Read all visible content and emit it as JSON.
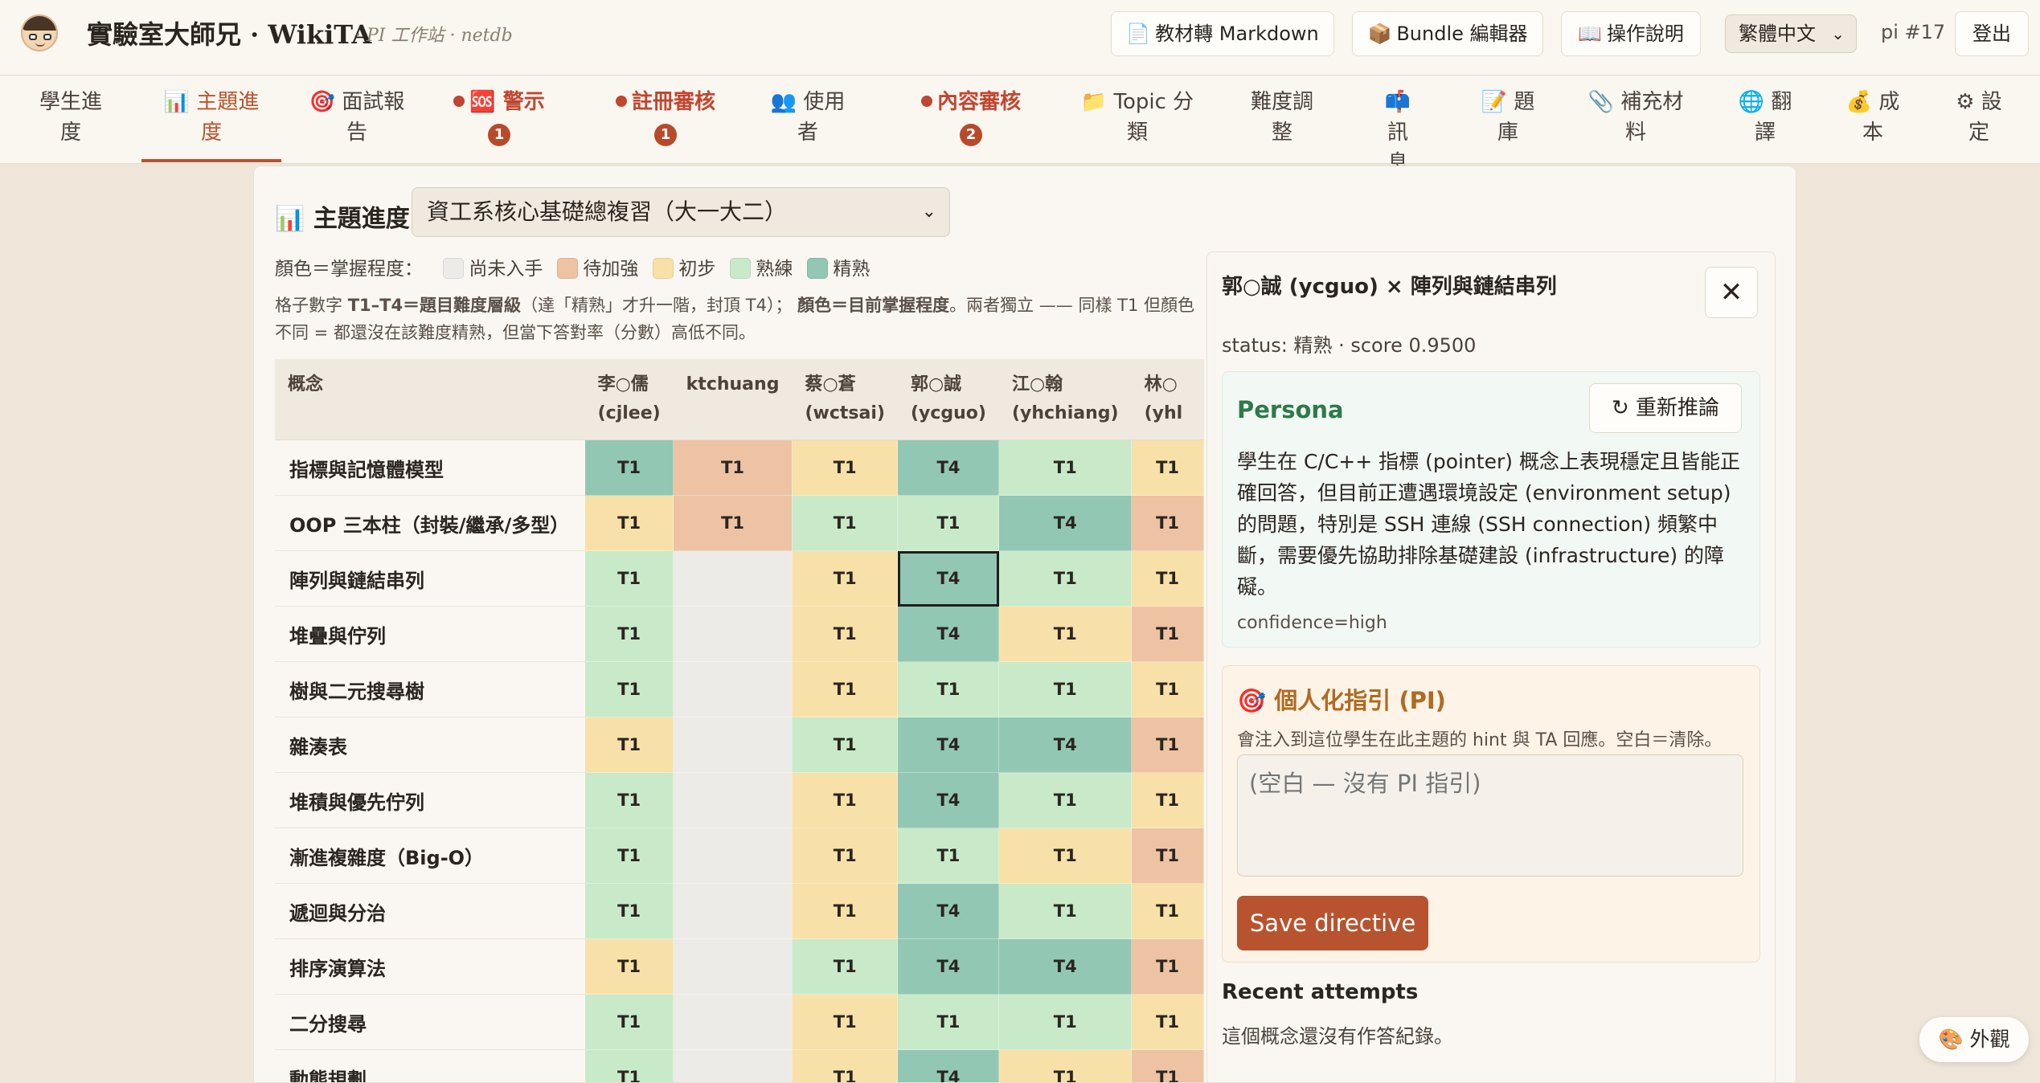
{
  "header": {
    "brand": "實驗室大師兄 · WikiTA",
    "subtitle": "· PI 工作站 · netdb",
    "buttons": [
      {
        "icon": "📄",
        "label": "教材轉 Markdown"
      },
      {
        "icon": "📦",
        "label": "Bundle 編輯器"
      },
      {
        "icon": "📖",
        "label": "操作說明"
      }
    ],
    "language": "繁體中文",
    "user_id": "pi #17",
    "logout": "登出"
  },
  "nav": {
    "tabs": [
      {
        "icon": "",
        "label": "學生進\n度",
        "badge": ""
      },
      {
        "icon": "📊",
        "label": "主題進\n度",
        "badge": ""
      },
      {
        "icon": "🎯",
        "label": "面試報\n告",
        "badge": ""
      },
      {
        "icon": "🆘",
        "label": "警示",
        "badge": "1"
      },
      {
        "icon": "",
        "label": "註冊審核",
        "badge": "1"
      },
      {
        "icon": "👥",
        "label": "使用\n者",
        "badge": ""
      },
      {
        "icon": "",
        "label": "內容審核",
        "badge": "2"
      },
      {
        "icon": "📁",
        "label": "Topic 分\n類",
        "badge": ""
      },
      {
        "icon": "",
        "label": "難度調\n整",
        "badge": ""
      },
      {
        "icon": "📫",
        "label": "訊\n息",
        "badge": ""
      },
      {
        "icon": "📝",
        "label": "題\n庫",
        "badge": ""
      },
      {
        "icon": "📎",
        "label": "補充材\n料",
        "badge": ""
      },
      {
        "icon": "🌐",
        "label": "翻\n譯",
        "badge": ""
      },
      {
        "icon": "💰",
        "label": "成\n本",
        "badge": ""
      },
      {
        "icon": "⚙",
        "label": "設\n定",
        "badge": ""
      }
    ]
  },
  "main": {
    "title_icon": "📊",
    "title": "主題進度",
    "topic_selected": "資工系核心基礎總複習（大一大二）",
    "legend_label": "顏色＝掌握程度：",
    "legend": [
      {
        "label": "尚未入手",
        "color": "#ecebe7"
      },
      {
        "label": "待加強",
        "color": "#edc3a4"
      },
      {
        "label": "初步",
        "color": "#f8e1a8"
      },
      {
        "label": "熟練",
        "color": "#c8eac9"
      },
      {
        "label": "精熟",
        "color": "#92c7b4"
      }
    ],
    "desc_a": "格子數字 ",
    "desc_b": "T1–T4＝題目難度層級",
    "desc_c": "（達「精熟」才升一階，封頂 T4）； ",
    "desc_d": "顏色＝目前掌握程度",
    "desc_e": "。兩者獨立 —— 同樣 T1 但顏色不同 = 都還沒在該難度精熟，但當下答對率（分數）高低不同。"
  },
  "table": {
    "concept_header": "概念",
    "students": [
      {
        "line1": "李○儒",
        "line2": "(cjlee)"
      },
      {
        "line1": "ktchuang",
        "line2": ""
      },
      {
        "line1": "蔡○蒼",
        "line2": "(wctsai)"
      },
      {
        "line1": "郭○誠",
        "line2": "(ycguo)"
      },
      {
        "line1": "江○翰",
        "line2": "(yhchiang)"
      },
      {
        "line1": "林○",
        "line2": "(yhl"
      }
    ],
    "rows": [
      {
        "concept": "指標與記憶體模型",
        "cells": [
          [
            "T1",
            4
          ],
          [
            "T1",
            1
          ],
          [
            "T1",
            2
          ],
          [
            "T4",
            4
          ],
          [
            "T1",
            3
          ],
          [
            "T1",
            2
          ]
        ]
      },
      {
        "concept": "OOP 三本柱（封裝/繼承/多型）",
        "cells": [
          [
            "T1",
            2
          ],
          [
            "T1",
            1
          ],
          [
            "T1",
            3
          ],
          [
            "T1",
            3
          ],
          [
            "T4",
            4
          ],
          [
            "T1",
            1
          ]
        ]
      },
      {
        "concept": "陣列與鏈結串列",
        "cells": [
          [
            "T1",
            3
          ],
          [
            "",
            0
          ],
          [
            "T1",
            2
          ],
          [
            "T4",
            4
          ],
          [
            "T1",
            3
          ],
          [
            "T1",
            2
          ]
        ]
      },
      {
        "concept": "堆疊與佇列",
        "cells": [
          [
            "T1",
            3
          ],
          [
            "",
            0
          ],
          [
            "T1",
            2
          ],
          [
            "T4",
            4
          ],
          [
            "T1",
            2
          ],
          [
            "T1",
            1
          ]
        ]
      },
      {
        "concept": "樹與二元搜尋樹",
        "cells": [
          [
            "T1",
            3
          ],
          [
            "",
            0
          ],
          [
            "T1",
            2
          ],
          [
            "T1",
            3
          ],
          [
            "T1",
            3
          ],
          [
            "T1",
            2
          ]
        ]
      },
      {
        "concept": "雜湊表",
        "cells": [
          [
            "T1",
            2
          ],
          [
            "",
            0
          ],
          [
            "T1",
            3
          ],
          [
            "T4",
            4
          ],
          [
            "T4",
            4
          ],
          [
            "T1",
            1
          ]
        ]
      },
      {
        "concept": "堆積與優先佇列",
        "cells": [
          [
            "T1",
            3
          ],
          [
            "",
            0
          ],
          [
            "T1",
            2
          ],
          [
            "T4",
            4
          ],
          [
            "T1",
            3
          ],
          [
            "T1",
            2
          ]
        ]
      },
      {
        "concept": "漸進複雜度（Big-O）",
        "cells": [
          [
            "T1",
            3
          ],
          [
            "",
            0
          ],
          [
            "T1",
            2
          ],
          [
            "T1",
            3
          ],
          [
            "T1",
            2
          ],
          [
            "T1",
            1
          ]
        ]
      },
      {
        "concept": "遞迴與分治",
        "cells": [
          [
            "T1",
            3
          ],
          [
            "",
            0
          ],
          [
            "T1",
            2
          ],
          [
            "T4",
            4
          ],
          [
            "T1",
            3
          ],
          [
            "T1",
            2
          ]
        ]
      },
      {
        "concept": "排序演算法",
        "cells": [
          [
            "T1",
            2
          ],
          [
            "",
            0
          ],
          [
            "T1",
            3
          ],
          [
            "T4",
            4
          ],
          [
            "T4",
            4
          ],
          [
            "T1",
            1
          ]
        ]
      },
      {
        "concept": "二分搜尋",
        "cells": [
          [
            "T1",
            3
          ],
          [
            "",
            0
          ],
          [
            "T1",
            2
          ],
          [
            "T1",
            3
          ],
          [
            "T1",
            3
          ],
          [
            "T1",
            2
          ]
        ]
      },
      {
        "concept": "動態規劃",
        "cells": [
          [
            "T1",
            3
          ],
          [
            "",
            0
          ],
          [
            "T1",
            2
          ],
          [
            "T4",
            4
          ],
          [
            "T1",
            2
          ],
          [
            "T1",
            1
          ]
        ]
      }
    ],
    "selected": {
      "row": 2,
      "col": 3
    }
  },
  "panel": {
    "title": "郭○誠 (ycguo) × 陣列與鏈結串列",
    "close": "✕",
    "status": "status: 精熟 · score 0.9500",
    "persona_title": "Persona",
    "reinfer_label": "重新推論",
    "persona_text": "學生在 C/C++ 指標 (pointer) 概念上表現穩定且皆能正確回答，但目前正遭遇環境設定 (environment setup) 的問題，特別是 SSH 連線 (SSH connection) 頻繁中斷，需要優先協助排除基礎建設 (infrastructure) 的障礙。",
    "confidence": "confidence=high",
    "pi_icon": "🎯",
    "pi_title": "個人化指引 (PI)",
    "pi_sub": "會注入到這位學生在此主題的 hint 與 TA 回應。空白＝清除。",
    "pi_placeholder": "(空白 — 沒有 PI 指引)",
    "save_label": "Save directive",
    "recent_title": "Recent attempts",
    "recent_empty": "這個概念還沒有作答紀錄。"
  },
  "skin_button": "🎨 外觀"
}
